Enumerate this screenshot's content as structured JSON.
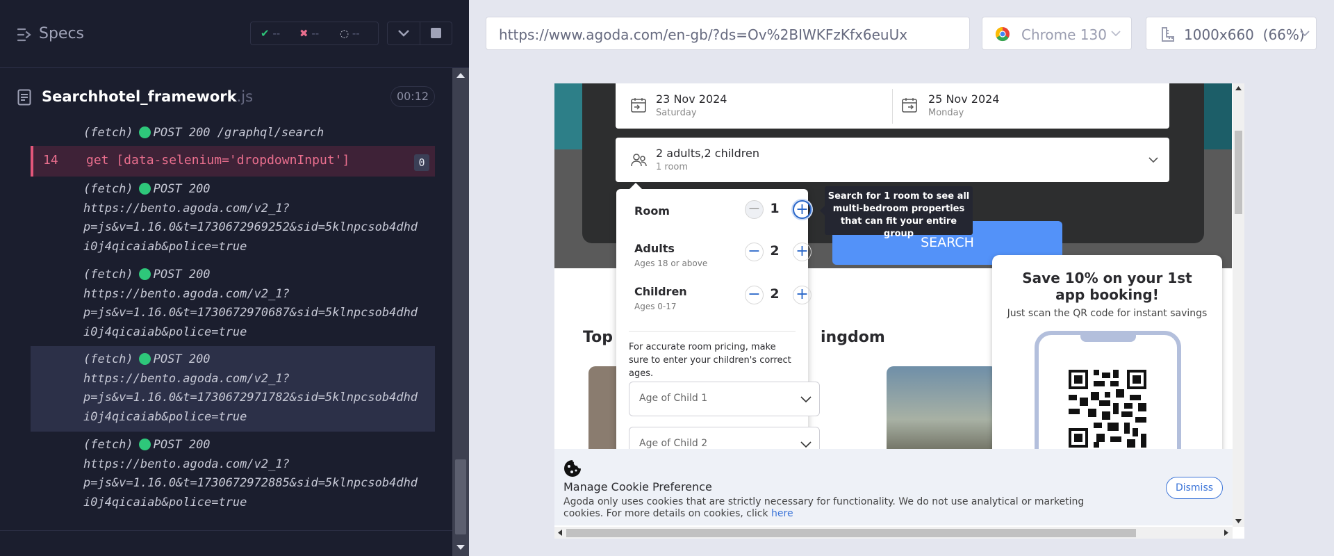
{
  "runner": {
    "specs_label": "Specs",
    "passed": "--",
    "failed": "--",
    "pending": "--",
    "spec_file": "Searchhotel_framework",
    "spec_ext": ".js",
    "timer": "00:12"
  },
  "log": {
    "fetch0": "(fetch)",
    "post0": "POST 200 /graphql/search",
    "cmd_num": "14",
    "cmd_text": "get  [data-selenium='dropdownInput']",
    "cmd_badge": "0",
    "entries": [
      {
        "label": "(fetch)",
        "method": "POST 200",
        "url1": "https://bento.agoda.com/v2_1?",
        "url2": "p=js&v=1.16.0&t=1730672969252&sid=5klnpcsob4dhd",
        "url3": "i0j4qicaiab&police=true"
      },
      {
        "label": "(fetch)",
        "method": "POST 200",
        "url1": "https://bento.agoda.com/v2_1?",
        "url2": "p=js&v=1.16.0&t=1730672970687&sid=5klnpcsob4dhd",
        "url3": "i0j4qicaiab&police=true"
      },
      {
        "label": "(fetch)",
        "method": "POST 200",
        "url1": "https://bento.agoda.com/v2_1?",
        "url2": "p=js&v=1.16.0&t=1730672971782&sid=5klnpcsob4dhd",
        "url3": "i0j4qicaiab&police=true"
      },
      {
        "label": "(fetch)",
        "method": "POST 200",
        "url1": "https://bento.agoda.com/v2_1?",
        "url2": "p=js&v=1.16.0&t=1730672972885&sid=5klnpcsob4dhd",
        "url3": "i0j4qicaiab&police=true"
      }
    ]
  },
  "browser": {
    "url": "https://www.agoda.com/en-gb/?ds=Ov%2BIWKFzKfx6euUx",
    "name": "Chrome 130",
    "viewport": "1000x660",
    "zoom": "(66%)"
  },
  "agoda": {
    "checkin_date": "23 Nov 2024",
    "checkin_day": "Saturday",
    "checkout_date": "25 Nov 2024",
    "checkout_day": "Monday",
    "occupancy_main": "2 adults,2 children",
    "occupancy_sub": "1 room",
    "room_label": "Room",
    "room_value": "1",
    "adults_label": "Adults",
    "adults_sub": "Ages 18 or above",
    "adults_value": "2",
    "children_label": "Children",
    "children_sub": "Ages 0-17",
    "children_value": "2",
    "tooltip": "Search for 1 room to see all multi-bedroom properties that can fit your entire group",
    "note": "For accurate room pricing, make sure to enter your children's correct ages.",
    "age1": "Age of Child 1",
    "age2": "Age of Child 2",
    "search": "SEARCH",
    "top_heading_start": "Top",
    "top_heading_end": "ingdom",
    "promo_title": "Save 10% on your 1st app booking!",
    "promo_sub": "Just scan the QR code for instant savings",
    "cookie_title": "Manage Cookie Preference",
    "cookie_text": "Agoda only uses cookies that are strictly necessary for functionality. We do not use analytical or marketing cookies. For more details on cookies, click",
    "cookie_link": "here",
    "dismiss": "Dismiss"
  },
  "colors": {
    "runner_bg": "#1b1e2e",
    "fail_cmd": "#ea6f8e",
    "pass_dot": "#2ec77a",
    "agoda_blue": "#5392f9"
  }
}
